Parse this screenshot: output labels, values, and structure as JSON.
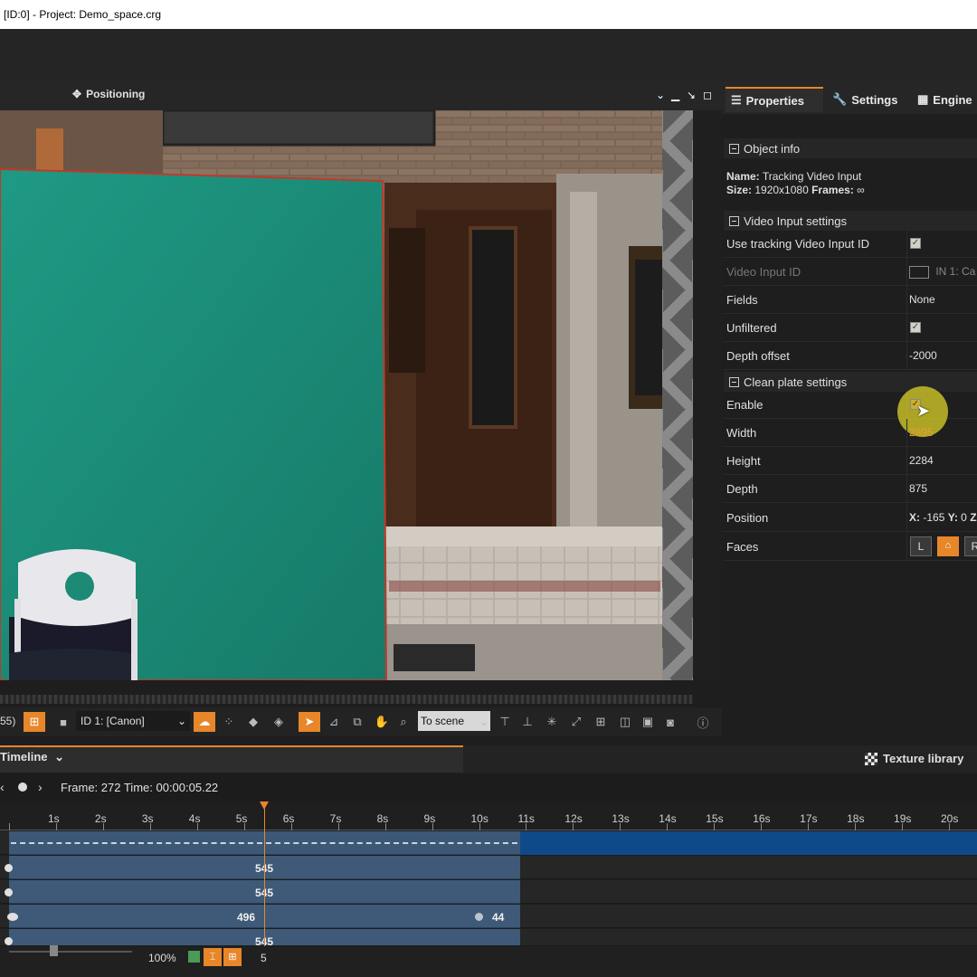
{
  "window": {
    "title": "[ID:0] - Project: Demo_space.crg"
  },
  "viewport": {
    "title": "Positioning"
  },
  "toolbar": {
    "frame_partial": "55)",
    "camera_select": "ID 1: [Canon]",
    "scene_select": "To scene"
  },
  "tabs": {
    "properties": "Properties",
    "settings": "Settings",
    "engine": "Engine"
  },
  "object_info": {
    "header": "Object info",
    "name_label": "Name:",
    "name_value": "Tracking Video Input",
    "size_label": "Size:",
    "size_value": "1920x1080",
    "frames_label": "Frames:",
    "frames_value": "∞"
  },
  "video_input": {
    "header": "Video Input settings",
    "rows": [
      {
        "label": "Use tracking Video Input ID",
        "value": "",
        "checked": true
      },
      {
        "label": "Video Input ID",
        "value": "IN 1: Ca"
      },
      {
        "label": "Fields",
        "value": "None"
      },
      {
        "label": "Unfiltered",
        "value": "",
        "checked": true
      },
      {
        "label": "Depth offset",
        "value": "-2000"
      }
    ]
  },
  "clean_plate": {
    "header": "Clean plate settings",
    "rows": [
      {
        "label": "Enable",
        "value": "",
        "checked": true
      },
      {
        "label": "Width",
        "value": "2895"
      },
      {
        "label": "Height",
        "value": "2284"
      },
      {
        "label": "Depth",
        "value": "875"
      },
      {
        "label": "Position",
        "x_label": "X:",
        "x_value": "-165",
        "y_label": "Y:",
        "y_value": "0",
        "z_label": "Z"
      },
      {
        "label": "Faces",
        "value": ""
      }
    ]
  },
  "timeline": {
    "title": "Timeline",
    "texture_library": "Texture library",
    "frame_info": "Frame: 272 Time: 00:00:05.22",
    "ruler": [
      "1s",
      "2s",
      "3s",
      "4s",
      "5s",
      "6s",
      "7s",
      "8s",
      "9s",
      "10s",
      "11s",
      "12s",
      "13s",
      "14s",
      "15s",
      "16s",
      "17s",
      "18s",
      "19s",
      "20s"
    ],
    "tracks": [
      {
        "key": "545"
      },
      {
        "key": "545"
      },
      {
        "key": "496",
        "key2": "44"
      },
      {
        "key": "545"
      }
    ]
  },
  "status": {
    "zoom": "100%",
    "value": "5"
  },
  "colors": {
    "accent": "#e8862a",
    "panel": "#1e1e1e",
    "track_bar": "#3e5a78"
  }
}
